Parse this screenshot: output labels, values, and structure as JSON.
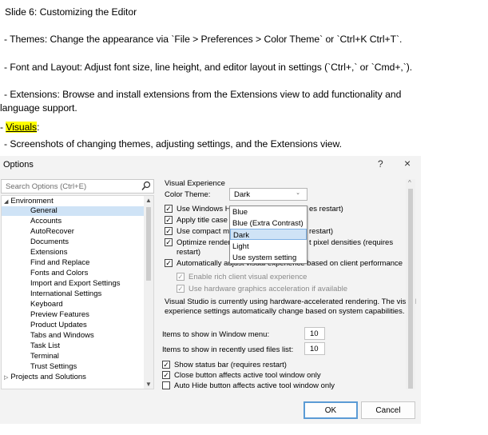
{
  "slide": {
    "title": "Slide 6: Customizing the Editor",
    "bullet_themes": " - Themes: Change the appearance via `File > Preferences > Color Theme` or `Ctrl+K Ctrl+T`.",
    "bullet_font": " - Font and Layout: Adjust font size, line height, and editor layout in settings (`Ctrl+,` or `Cmd+,`).",
    "bullet_ext_line1": " - Extensions: Browse and install extensions from the Extensions view to add functionality and",
    "bullet_ext_line2": "language support.",
    "visuals_prefix": "- ",
    "visuals_label": "Visuals",
    "visuals_suffix": ":",
    "screenshots": " - Screenshots of changing themes, adjusting settings, and the Extensions view.",
    "highlight_color": "#ffff00"
  },
  "dialog": {
    "title": "Options",
    "help": "?",
    "close": "×",
    "search_placeholder": "Search Options (Ctrl+E)",
    "tree": {
      "root_expanded": "Environment",
      "children": [
        "General",
        "Accounts",
        "AutoRecover",
        "Documents",
        "Extensions",
        "Find and Replace",
        "Fonts and Colors",
        "Import and Export Settings",
        "International Settings",
        "Keyboard",
        "Preview Features",
        "Product Updates",
        "Tabs and Windows",
        "Task List",
        "Terminal",
        "Trust Settings"
      ],
      "selected": "General",
      "root_collapsed": "Projects and Solutions"
    },
    "panel": {
      "section_title": "Visual Experience",
      "color_theme_label": "Color Theme:",
      "color_theme_value": "Dark",
      "opt_windows": "Use Windows Hig",
      "opt_windows_tail": "es restart)",
      "opt_title_case": "Apply title case s",
      "opt_compact": "Use compact me",
      "opt_compact_tail": "restart)",
      "opt_optimize": "Optimize renderi",
      "opt_optimize_tail": "t pixel densities (requires",
      "opt_optimize_line2": "restart)",
      "opt_auto_adjust": "Automatically adjust visual experience based on client performance",
      "opt_rich": "Enable rich client visual experience",
      "opt_hw": "Use hardware graphics acceleration if available",
      "info_line1": "Visual Studio is currently using hardware-accelerated rendering. The visual",
      "info_line2": "experience settings automatically change based on system capabilities.",
      "window_menu_label": "Items to show in Window menu:",
      "window_menu_value": "10",
      "recent_files_label": "Items to show in recently used files list:",
      "recent_files_value": "10",
      "opt_status_bar": "Show status bar (requires restart)",
      "opt_close_button": "Close button affects active tool window only",
      "opt_auto_hide": "Auto Hide button affects active tool window only"
    },
    "dropdown": {
      "options": [
        "Blue",
        "Blue (Extra Contrast)",
        "Dark",
        "Light",
        "Use system setting"
      ],
      "selected": "Dark"
    },
    "ok_label": "OK",
    "cancel_label": "Cancel",
    "accent_color": "#5b9bd5",
    "selection_color": "#cfe3f6"
  }
}
